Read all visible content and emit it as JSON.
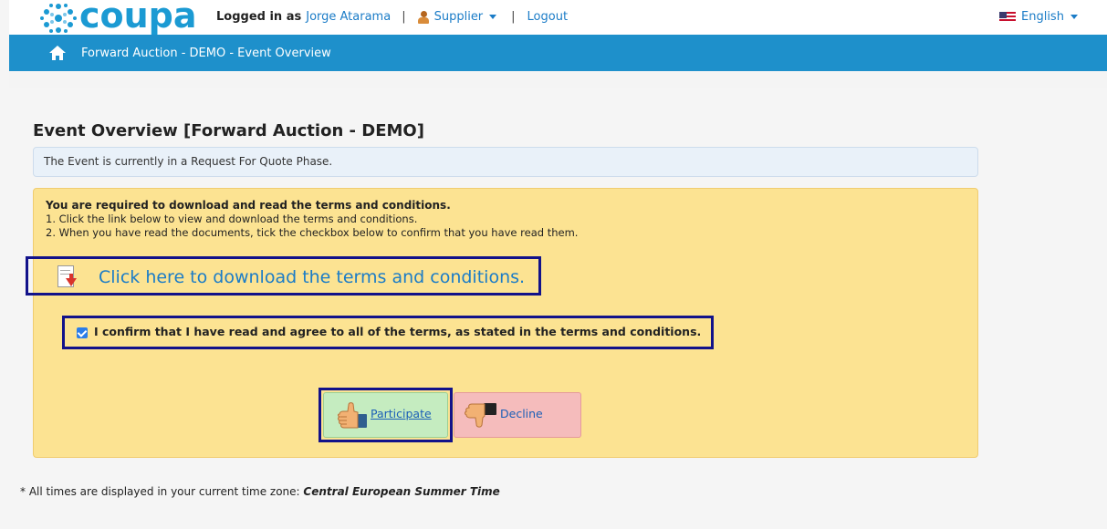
{
  "header": {
    "logo_text": "coupa",
    "logged_in_label": "Logged in as",
    "user_name": "Jorge Atarama",
    "separator": "|",
    "role_menu": "Supplier",
    "logout": "Logout",
    "language": "English"
  },
  "nav": {
    "breadcrumb": "Forward Auction - DEMO - Event Overview"
  },
  "main": {
    "title": "Event Overview [Forward Auction - DEMO]",
    "phase_notice": "The Event is currently in a Request For Quote Phase.",
    "terms": {
      "heading": "You are required to download and read the terms and conditions.",
      "step1": "1. Click the link below to view and download the terms and conditions.",
      "step2": "2. When you have read the documents, tick the checkbox below to confirm that you have read them.",
      "download_link": "Click here to download the terms and conditions.",
      "confirm_label": "I confirm that I have read and agree to all of the terms, as stated in the terms and conditions.",
      "confirm_checked": true
    },
    "participate_label": "Participate",
    "decline_label": "Decline"
  },
  "footer": {
    "timezone_prefix": "* All times are displayed in your current time zone:",
    "timezone_value": "Central European Summer Time"
  },
  "colors": {
    "brand": "#1b9ad3",
    "navbar": "#1e90cb",
    "terms_bg": "#fce392",
    "participate_bg": "#c5ecc0",
    "decline_bg": "#f5bcbc",
    "highlight_frame": "#12128a"
  }
}
